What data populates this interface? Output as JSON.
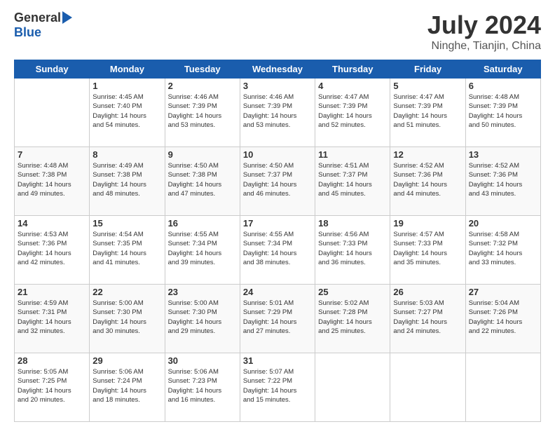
{
  "header": {
    "logo_general": "General",
    "logo_blue": "Blue",
    "title": "July 2024",
    "location": "Ninghe, Tianjin, China"
  },
  "days_of_week": [
    "Sunday",
    "Monday",
    "Tuesday",
    "Wednesday",
    "Thursday",
    "Friday",
    "Saturday"
  ],
  "weeks": [
    [
      {
        "day": "",
        "info": ""
      },
      {
        "day": "1",
        "info": "Sunrise: 4:45 AM\nSunset: 7:40 PM\nDaylight: 14 hours\nand 54 minutes."
      },
      {
        "day": "2",
        "info": "Sunrise: 4:46 AM\nSunset: 7:39 PM\nDaylight: 14 hours\nand 53 minutes."
      },
      {
        "day": "3",
        "info": "Sunrise: 4:46 AM\nSunset: 7:39 PM\nDaylight: 14 hours\nand 53 minutes."
      },
      {
        "day": "4",
        "info": "Sunrise: 4:47 AM\nSunset: 7:39 PM\nDaylight: 14 hours\nand 52 minutes."
      },
      {
        "day": "5",
        "info": "Sunrise: 4:47 AM\nSunset: 7:39 PM\nDaylight: 14 hours\nand 51 minutes."
      },
      {
        "day": "6",
        "info": "Sunrise: 4:48 AM\nSunset: 7:39 PM\nDaylight: 14 hours\nand 50 minutes."
      }
    ],
    [
      {
        "day": "7",
        "info": "Sunrise: 4:48 AM\nSunset: 7:38 PM\nDaylight: 14 hours\nand 49 minutes."
      },
      {
        "day": "8",
        "info": "Sunrise: 4:49 AM\nSunset: 7:38 PM\nDaylight: 14 hours\nand 48 minutes."
      },
      {
        "day": "9",
        "info": "Sunrise: 4:50 AM\nSunset: 7:38 PM\nDaylight: 14 hours\nand 47 minutes."
      },
      {
        "day": "10",
        "info": "Sunrise: 4:50 AM\nSunset: 7:37 PM\nDaylight: 14 hours\nand 46 minutes."
      },
      {
        "day": "11",
        "info": "Sunrise: 4:51 AM\nSunset: 7:37 PM\nDaylight: 14 hours\nand 45 minutes."
      },
      {
        "day": "12",
        "info": "Sunrise: 4:52 AM\nSunset: 7:36 PM\nDaylight: 14 hours\nand 44 minutes."
      },
      {
        "day": "13",
        "info": "Sunrise: 4:52 AM\nSunset: 7:36 PM\nDaylight: 14 hours\nand 43 minutes."
      }
    ],
    [
      {
        "day": "14",
        "info": "Sunrise: 4:53 AM\nSunset: 7:36 PM\nDaylight: 14 hours\nand 42 minutes."
      },
      {
        "day": "15",
        "info": "Sunrise: 4:54 AM\nSunset: 7:35 PM\nDaylight: 14 hours\nand 41 minutes."
      },
      {
        "day": "16",
        "info": "Sunrise: 4:55 AM\nSunset: 7:34 PM\nDaylight: 14 hours\nand 39 minutes."
      },
      {
        "day": "17",
        "info": "Sunrise: 4:55 AM\nSunset: 7:34 PM\nDaylight: 14 hours\nand 38 minutes."
      },
      {
        "day": "18",
        "info": "Sunrise: 4:56 AM\nSunset: 7:33 PM\nDaylight: 14 hours\nand 36 minutes."
      },
      {
        "day": "19",
        "info": "Sunrise: 4:57 AM\nSunset: 7:33 PM\nDaylight: 14 hours\nand 35 minutes."
      },
      {
        "day": "20",
        "info": "Sunrise: 4:58 AM\nSunset: 7:32 PM\nDaylight: 14 hours\nand 33 minutes."
      }
    ],
    [
      {
        "day": "21",
        "info": "Sunrise: 4:59 AM\nSunset: 7:31 PM\nDaylight: 14 hours\nand 32 minutes."
      },
      {
        "day": "22",
        "info": "Sunrise: 5:00 AM\nSunset: 7:30 PM\nDaylight: 14 hours\nand 30 minutes."
      },
      {
        "day": "23",
        "info": "Sunrise: 5:00 AM\nSunset: 7:30 PM\nDaylight: 14 hours\nand 29 minutes."
      },
      {
        "day": "24",
        "info": "Sunrise: 5:01 AM\nSunset: 7:29 PM\nDaylight: 14 hours\nand 27 minutes."
      },
      {
        "day": "25",
        "info": "Sunrise: 5:02 AM\nSunset: 7:28 PM\nDaylight: 14 hours\nand 25 minutes."
      },
      {
        "day": "26",
        "info": "Sunrise: 5:03 AM\nSunset: 7:27 PM\nDaylight: 14 hours\nand 24 minutes."
      },
      {
        "day": "27",
        "info": "Sunrise: 5:04 AM\nSunset: 7:26 PM\nDaylight: 14 hours\nand 22 minutes."
      }
    ],
    [
      {
        "day": "28",
        "info": "Sunrise: 5:05 AM\nSunset: 7:25 PM\nDaylight: 14 hours\nand 20 minutes."
      },
      {
        "day": "29",
        "info": "Sunrise: 5:06 AM\nSunset: 7:24 PM\nDaylight: 14 hours\nand 18 minutes."
      },
      {
        "day": "30",
        "info": "Sunrise: 5:06 AM\nSunset: 7:23 PM\nDaylight: 14 hours\nand 16 minutes."
      },
      {
        "day": "31",
        "info": "Sunrise: 5:07 AM\nSunset: 7:22 PM\nDaylight: 14 hours\nand 15 minutes."
      },
      {
        "day": "",
        "info": ""
      },
      {
        "day": "",
        "info": ""
      },
      {
        "day": "",
        "info": ""
      }
    ]
  ]
}
